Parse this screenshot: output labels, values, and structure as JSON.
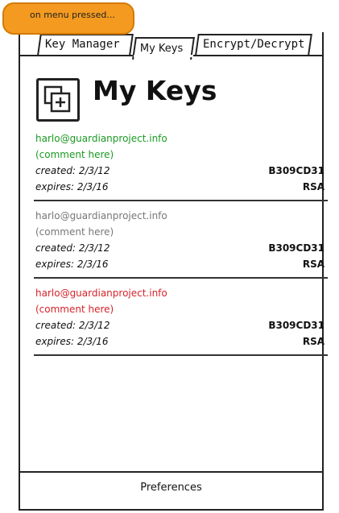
{
  "note": {
    "text": "on menu pressed..."
  },
  "tabs": [
    {
      "label": "Key Manager"
    },
    {
      "label": "My Keys"
    },
    {
      "label": "Encrypt/Decrypt"
    }
  ],
  "header": {
    "title": "My Keys",
    "icon": "add-key-icon"
  },
  "keys": [
    {
      "email": "harlo@guardianproject.info",
      "comment": "(comment here)",
      "created": "created: 2/3/12",
      "key_id": "B309CD31",
      "expires": "expires: 2/3/16",
      "algorithm": "RSA",
      "color": "#1a9a22"
    },
    {
      "email": "harlo@guardianproject.info",
      "comment": "(comment here)",
      "created": "created: 2/3/12",
      "key_id": "B309CD31",
      "expires": "expires: 2/3/16",
      "algorithm": "RSA",
      "color": "#777777"
    },
    {
      "email": "harlo@guardianproject.info",
      "comment": "(comment here)",
      "created": "created: 2/3/12",
      "key_id": "B309CD31",
      "expires": "expires: 2/3/16",
      "algorithm": "RSA",
      "color": "#d6232a"
    }
  ],
  "footer": {
    "preferences_label": "Preferences"
  }
}
